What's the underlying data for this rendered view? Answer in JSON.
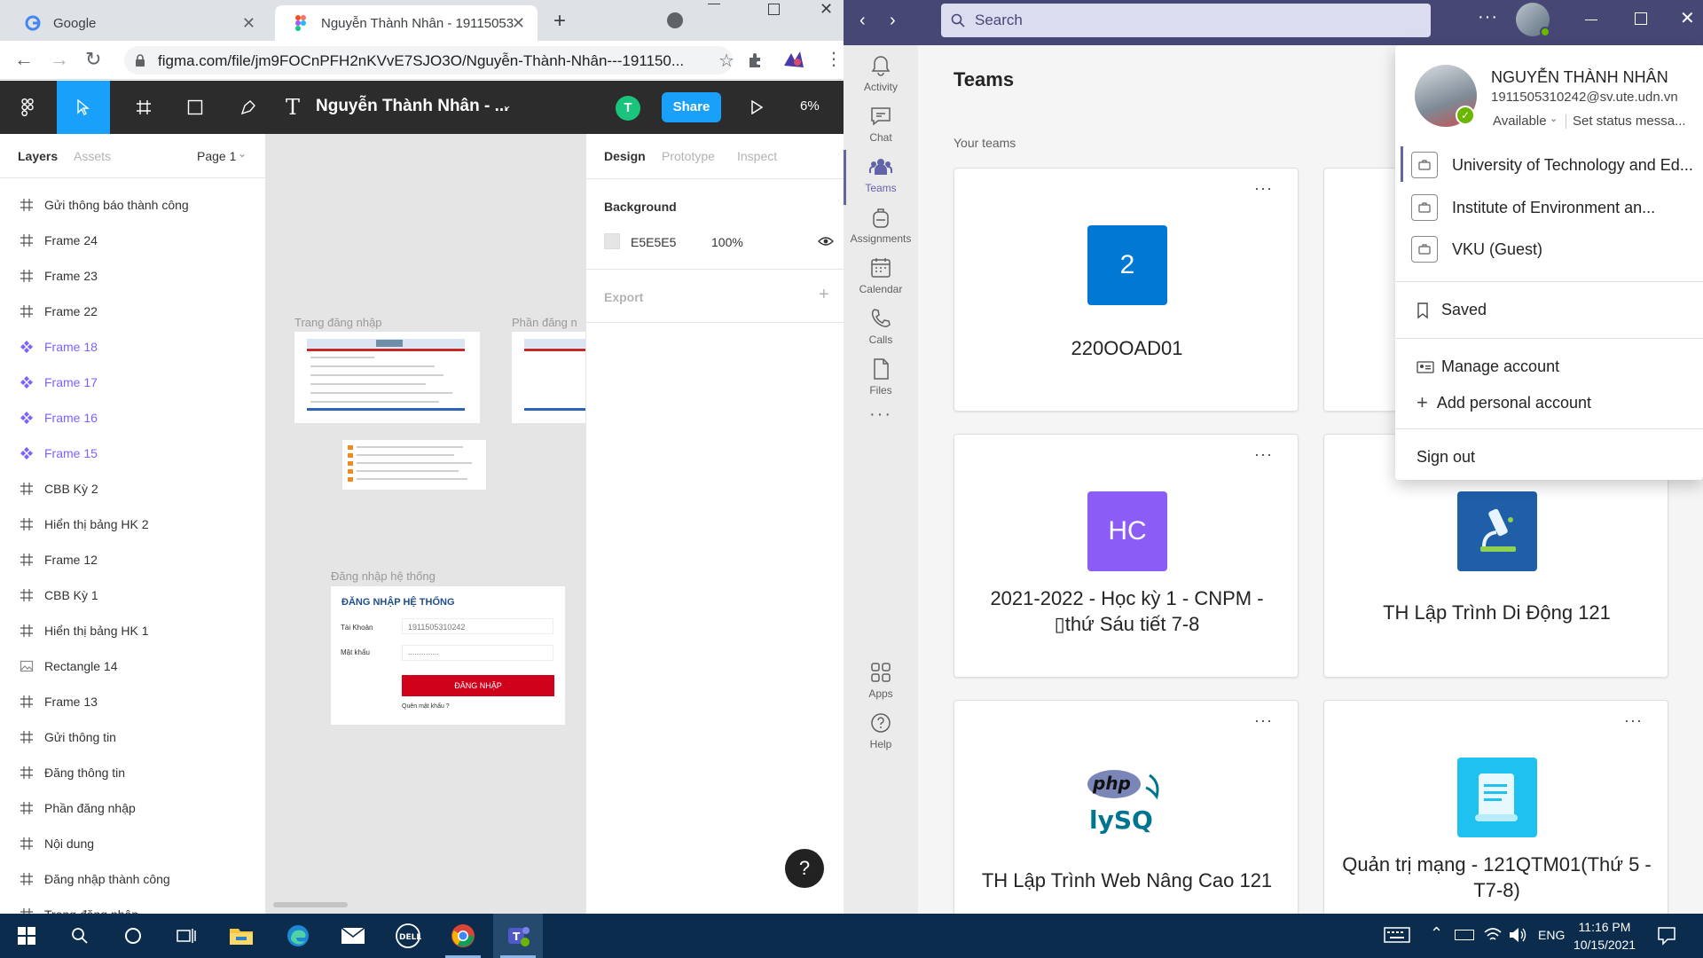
{
  "chrome": {
    "tabs": [
      {
        "title": "Google",
        "active": false
      },
      {
        "title": "Nguyễn Thành Nhân - 19115053",
        "active": true
      }
    ],
    "url": "figma.com/file/jm9FOCnPFH2nKVvE7SJO3O/Nguyễn-Thành-Nhân---191150..."
  },
  "figma": {
    "file_name": "Nguyễn Thành Nhân - ...",
    "share_label": "Share",
    "user_initial": "T",
    "zoom": "6%",
    "layers_tab": "Layers",
    "assets_tab": "Assets",
    "page": "Page 1",
    "layers": [
      {
        "name": "Gửi thông báo thành công",
        "kind": "frame"
      },
      {
        "name": "Frame 24",
        "kind": "frame"
      },
      {
        "name": "Frame 23",
        "kind": "frame"
      },
      {
        "name": "Frame 22",
        "kind": "frame"
      },
      {
        "name": "Frame 18",
        "kind": "component"
      },
      {
        "name": "Frame 17",
        "kind": "component"
      },
      {
        "name": "Frame 16",
        "kind": "component"
      },
      {
        "name": "Frame 15",
        "kind": "component"
      },
      {
        "name": "CBB Kỳ 2",
        "kind": "frame"
      },
      {
        "name": "Hiển thị bảng HK 2",
        "kind": "frame"
      },
      {
        "name": "Frame 12",
        "kind": "frame"
      },
      {
        "name": "CBB Kỳ 1",
        "kind": "frame"
      },
      {
        "name": "Hiển thị bảng HK 1",
        "kind": "frame"
      },
      {
        "name": "Rectangle 14",
        "kind": "image"
      },
      {
        "name": "Frame 13",
        "kind": "frame"
      },
      {
        "name": "Gửi thông tin",
        "kind": "frame"
      },
      {
        "name": "Đăng thông tin",
        "kind": "frame"
      },
      {
        "name": "Phần đăng nhập",
        "kind": "frame"
      },
      {
        "name": "Nội dung",
        "kind": "frame"
      },
      {
        "name": "Đăng nhập thành công",
        "kind": "frame"
      },
      {
        "name": "Trang đăng nhập",
        "kind": "frame"
      }
    ],
    "canvas": {
      "label_trang": "Trang đăng nhập",
      "label_phan": "Phần đăng n",
      "label_dangnhap": "Đăng nhập hệ thống",
      "login": {
        "heading": "ĐĂNG NHẬP HỆ THỐNG",
        "user_label": "Tài Khoản",
        "user_value": "1911505310242",
        "pass_label": "Mật khẩu",
        "pass_value": "..............",
        "button": "ĐĂNG NHẬP",
        "forgot": "Quên mật khẩu ?"
      }
    },
    "design": {
      "tabs": [
        "Design",
        "Prototype",
        "Inspect"
      ],
      "background_label": "Background",
      "bg_hex": "E5E5E5",
      "bg_opacity": "100%",
      "export_label": "Export"
    },
    "help": "?"
  },
  "teams": {
    "search_placeholder": "Search",
    "rail": [
      {
        "label": "Activity",
        "icon": "bell-icon"
      },
      {
        "label": "Chat",
        "icon": "chat-icon"
      },
      {
        "label": "Teams",
        "icon": "teams-icon",
        "active": true
      },
      {
        "label": "Assignments",
        "icon": "backpack-icon"
      },
      {
        "label": "Calendar",
        "icon": "calendar-icon"
      },
      {
        "label": "Calls",
        "icon": "phone-icon"
      },
      {
        "label": "Files",
        "icon": "file-icon"
      }
    ],
    "rail_bottom": [
      {
        "label": "Apps",
        "icon": "apps-icon"
      },
      {
        "label": "Help",
        "icon": "help-icon"
      }
    ],
    "title": "Teams",
    "your_teams": "Your teams",
    "cards": [
      {
        "name": "220OOAD01",
        "tile_text": "2",
        "tile_color": "#0078d4"
      },
      {
        "name": "2021-2022 - Học kỳ 1 - CNPM - ▯thứ Sáu tiết 7-8",
        "tile_text": "HC",
        "tile_color": "#8b5cf6"
      },
      {
        "name": "TH Lập Trình Di Động 121",
        "tile_text": "",
        "tile_color": "#1e5fa8"
      },
      {
        "name": "TH Lập Trình Web Nâng Cao 121",
        "tile_text": "",
        "tile_color": "#ffffff"
      },
      {
        "name": "Quản trị mạng - 121QTM01(Thứ 5 -T7-8)",
        "tile_text": "",
        "tile_color": "#1ec1f0"
      }
    ],
    "account": {
      "name": "NGUYỄN THÀNH NHÂN",
      "email": "1911505310242@sv.ute.udn.vn",
      "status": "Available",
      "set_status": "Set status messa...",
      "orgs": [
        "University of Technology and Ed...",
        "Institute of Environment an...",
        "VKU (Guest)"
      ],
      "saved": "Saved",
      "manage": "Manage account",
      "add_personal": "Add personal account",
      "sign_out": "Sign out"
    }
  },
  "taskbar": {
    "lang": "ENG",
    "time": "11:16 PM",
    "date": "10/15/2021"
  }
}
